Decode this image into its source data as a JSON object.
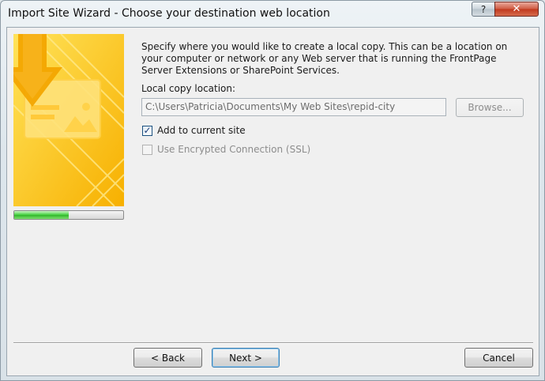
{
  "window": {
    "title": "Import Site Wizard - Choose your destination web location",
    "help_glyph": "?",
    "close_glyph": "✕"
  },
  "wizard": {
    "progress_fraction": 0.5,
    "description": "Specify where you would like to create a local copy.  This can be a location on your computer or network or any Web server that is running the FrontPage Server Extensions or SharePoint Services.",
    "local_copy_label": "Local copy location:",
    "local_copy_value": "C:\\Users\\Patricia\\Documents\\My Web Sites\\repid-city",
    "browse_label": "Browse...",
    "add_to_site_label": "Add to current site",
    "add_to_site_checked": true,
    "ssl_label": "Use Encrypted Connection (SSL)",
    "ssl_checked": false
  },
  "footer": {
    "back_label": "< Back",
    "next_label": "Next >",
    "cancel_label": "Cancel"
  },
  "colors": {
    "art_yellow": "#ffc400",
    "progress_green": "#3fcf3a"
  }
}
